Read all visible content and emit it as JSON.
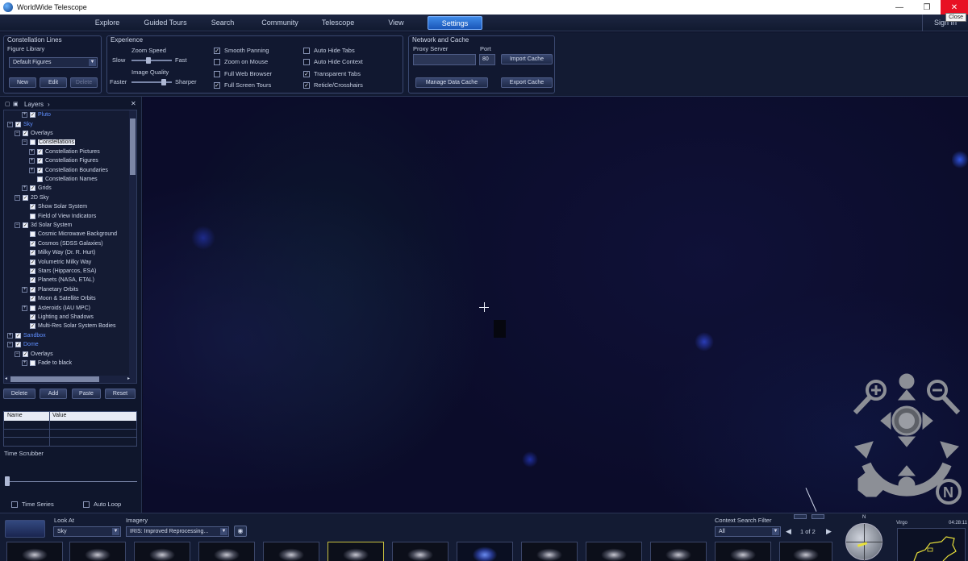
{
  "window": {
    "title": "WorldWide Telescope",
    "tooltip": "Close",
    "min_glyph": "—",
    "max_glyph": "❐",
    "close_glyph": "✕"
  },
  "menu": {
    "items": [
      "Explore",
      "Guided Tours",
      "Search",
      "Community",
      "Telescope",
      "View",
      "Settings"
    ],
    "active": "Settings",
    "signin": "Sign In"
  },
  "constellation_lines": {
    "title": "Constellation Lines",
    "figure_library_label": "Figure Library",
    "figure_library_value": "Default Figures",
    "buttons": {
      "new": "New",
      "edit": "Edit",
      "delete": "Delete"
    }
  },
  "experience": {
    "title": "Experience",
    "zoom_speed_label": "Zoom Speed",
    "slow": "Slow",
    "fast": "Fast",
    "zoom_speed_level": 0.4,
    "image_quality_label": "Image Quality",
    "faster": "Faster",
    "sharper": "Sharper",
    "image_quality_level": 0.85,
    "checks": [
      {
        "label": "Smooth Panning",
        "checked": true
      },
      {
        "label": "Zoom on Mouse",
        "checked": false
      },
      {
        "label": "Full Web Browser",
        "checked": false
      },
      {
        "label": "Full Screen Tours",
        "checked": true
      },
      {
        "label": "Auto Hide Tabs",
        "checked": false
      },
      {
        "label": "Auto Hide Context",
        "checked": false
      },
      {
        "label": "Transparent Tabs",
        "checked": true
      },
      {
        "label": "Reticle/Crosshairs",
        "checked": true
      }
    ]
  },
  "network": {
    "title": "Network and Cache",
    "proxy_label": "Proxy Server",
    "port_label": "Port",
    "proxy_value": "",
    "port_value": "80",
    "import_cache": "Import Cache",
    "manage_cache": "Manage Data Cache",
    "export_cache": "Export Cache"
  },
  "layers": {
    "title": "Layers",
    "close_glyph": "✕",
    "items": [
      {
        "label": "Pluto",
        "level": 2,
        "toggle": "+",
        "checked": true,
        "link": true
      },
      {
        "label": "Sky",
        "level": 0,
        "toggle": "−",
        "checked": true,
        "link": true
      },
      {
        "label": "Overlays",
        "level": 1,
        "toggle": "−",
        "checked": true
      },
      {
        "label": "Constellations",
        "level": 2,
        "toggle": "−",
        "checked": false,
        "selected": true
      },
      {
        "label": "Constellation Pictures",
        "level": 3,
        "toggle": "+",
        "checked": true
      },
      {
        "label": "Constellation Figures",
        "level": 3,
        "toggle": "+",
        "checked": true
      },
      {
        "label": "Constellation Boundaries",
        "level": 3,
        "toggle": "+",
        "checked": true
      },
      {
        "label": "Constellation Names",
        "level": 3,
        "toggle": "",
        "checked": false
      },
      {
        "label": "Grids",
        "level": 2,
        "toggle": "+",
        "checked": true
      },
      {
        "label": "2D Sky",
        "level": 1,
        "toggle": "−",
        "checked": true
      },
      {
        "label": "Show Solar System",
        "level": 2,
        "toggle": "",
        "checked": true
      },
      {
        "label": "Field of View Indicators",
        "level": 2,
        "toggle": "",
        "checked": false
      },
      {
        "label": "3d Solar System",
        "level": 1,
        "toggle": "−",
        "checked": true
      },
      {
        "label": "Cosmic Microwave Background",
        "level": 2,
        "toggle": "",
        "checked": false
      },
      {
        "label": "Cosmos (SDSS Galaxies)",
        "level": 2,
        "toggle": "",
        "checked": true
      },
      {
        "label": "Milky Way (Dr. R. Hurt)",
        "level": 2,
        "toggle": "",
        "checked": true
      },
      {
        "label": "Volumetric Milky Way",
        "level": 2,
        "toggle": "",
        "checked": true
      },
      {
        "label": "Stars (Hipparcos, ESA)",
        "level": 2,
        "toggle": "",
        "checked": true
      },
      {
        "label": "Planets (NASA, ETAL)",
        "level": 2,
        "toggle": "",
        "checked": true
      },
      {
        "label": "Planetary Orbits",
        "level": 2,
        "toggle": "+",
        "checked": true
      },
      {
        "label": "Moon & Satellite Orbits",
        "level": 2,
        "toggle": "",
        "checked": true
      },
      {
        "label": "Asteroids (IAU MPC)",
        "level": 2,
        "toggle": "+",
        "checked": false
      },
      {
        "label": "Lighting and Shadows",
        "level": 2,
        "toggle": "",
        "checked": true
      },
      {
        "label": "Multi-Res Solar System Bodies",
        "level": 2,
        "toggle": "",
        "checked": true
      },
      {
        "label": "Sandbox",
        "level": 0,
        "toggle": "+",
        "checked": true,
        "link": true
      },
      {
        "label": "Dome",
        "level": 0,
        "toggle": "−",
        "checked": true,
        "link": true
      },
      {
        "label": "Overlays",
        "level": 1,
        "toggle": "−",
        "checked": true
      },
      {
        "label": "Fade to black",
        "level": 2,
        "toggle": "+",
        "checked": false
      }
    ],
    "buttons": {
      "delete": "Delete",
      "add": "Add",
      "paste": "Paste",
      "reset": "Reset"
    },
    "grid_headers": {
      "name": "Name",
      "value": "Value"
    },
    "time_scrubber": "Time Scrubber",
    "time_series": "Time Series",
    "auto_loop": "Auto Loop"
  },
  "bottom": {
    "look_at_label": "Look At",
    "look_at_value": "Sky",
    "imagery_label": "Imagery",
    "imagery_value": "IRIS: Improved Reprocessing...",
    "context_filter_label": "Context Search Filter",
    "context_filter_value": "All",
    "page_indicator": "1 of 2",
    "constellation": "Virgo",
    "time": "04:28:11",
    "compass_n": "N"
  },
  "colors": {
    "accent": "#2f77d8",
    "link": "#5f8fff",
    "close_red": "#e81123"
  }
}
